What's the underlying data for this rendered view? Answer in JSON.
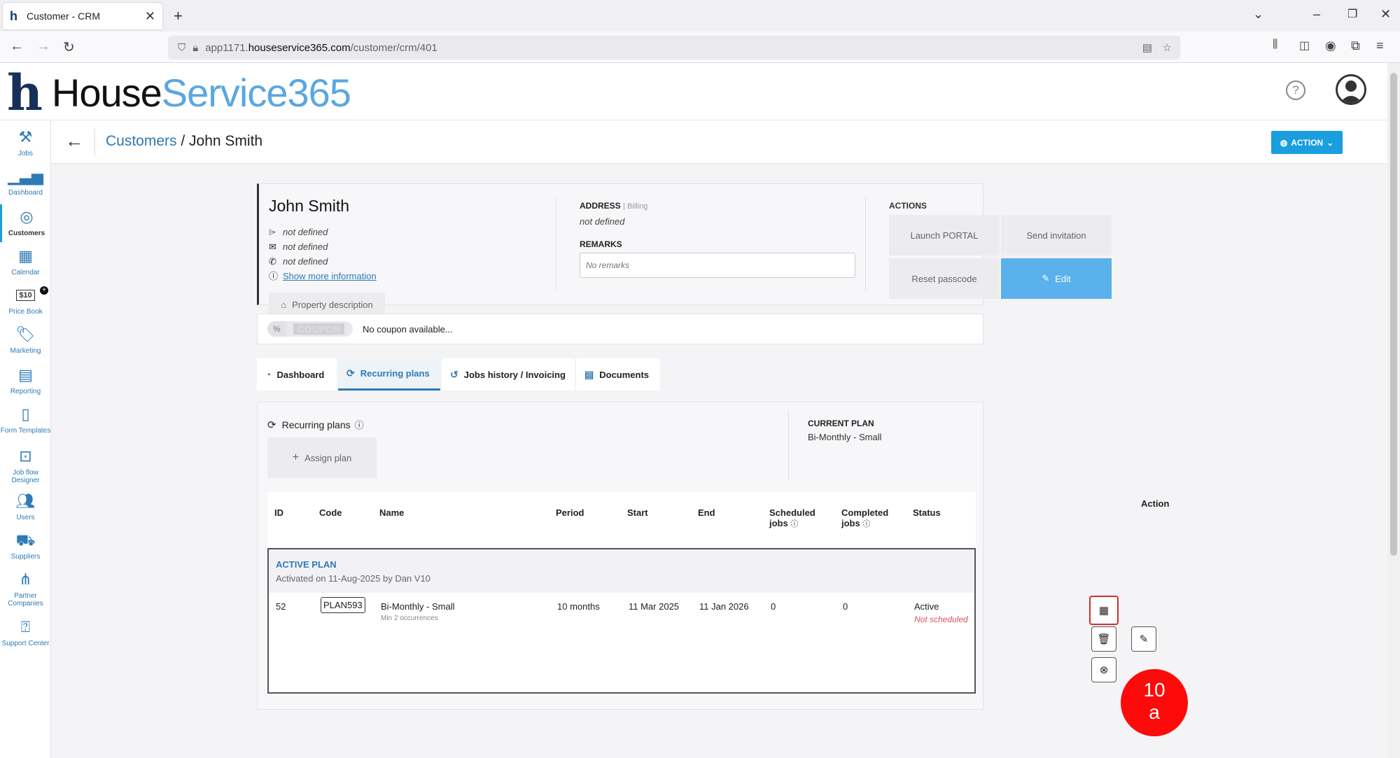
{
  "browser": {
    "tab_title": "Customer - CRM",
    "tab_close": "✕",
    "new_tab": "+",
    "url_prefix": "app1171.",
    "url_domain": "houseservice365.com",
    "url_path": "/customer/crm/401"
  },
  "app": {
    "logo_part1": "House",
    "logo_part2": "Service365"
  },
  "sidebar": {
    "items": [
      {
        "label": "Jobs",
        "icon": "tools-icon"
      },
      {
        "label": "Dashboard",
        "icon": "bar-chart-icon"
      },
      {
        "label": "Customers",
        "icon": "target-icon"
      },
      {
        "label": "Calendar",
        "icon": "calendar-icon"
      },
      {
        "label": "Price Book",
        "icon": "price-tag-icon",
        "badge": "$10"
      },
      {
        "label": "Marketing",
        "icon": "tag-icon"
      },
      {
        "label": "Reporting",
        "icon": "report-icon"
      },
      {
        "label": "Form Templates",
        "icon": "form-icon"
      },
      {
        "label": "Job flow Designer",
        "icon": "flow-icon"
      },
      {
        "label": "Users",
        "icon": "users-icon"
      },
      {
        "label": "Suppliers",
        "icon": "truck-icon"
      },
      {
        "label": "Partner Companies",
        "icon": "partners-icon"
      },
      {
        "label": "Support Center",
        "icon": "help-icon"
      }
    ]
  },
  "breadcrumb": {
    "parent": "Customers",
    "separator": " / ",
    "current": "John Smith"
  },
  "action_button": "ACTION",
  "customer": {
    "name": "John Smith",
    "field1": "not defined",
    "field2": "not defined",
    "field3": "not defined",
    "show_more": "Show more information",
    "property_description": "Property description",
    "address_label": "ADDRESS",
    "address_sub": "Billing",
    "address_value": "not defined",
    "remarks_label": "REMARKS",
    "remarks_placeholder": "No remarks",
    "actions_label": "ACTIONS",
    "launch_portal": "Launch PORTAL",
    "send_invitation": "Send invitation",
    "reset_passcode": "Reset passcode",
    "edit": "Edit"
  },
  "coupon": {
    "pct": "%",
    "label": "COUPON",
    "text": "No coupon available..."
  },
  "tabs": [
    {
      "label": "Dashboard"
    },
    {
      "label": "Recurring plans"
    },
    {
      "label": "Jobs history / Invoicing"
    },
    {
      "label": "Documents"
    }
  ],
  "plans": {
    "title": "Recurring plans",
    "assign": "Assign plan",
    "current_plan_label": "CURRENT PLAN",
    "current_plan_value": "Bi-Monthly - Small",
    "columns": {
      "id": "ID",
      "code": "Code",
      "name": "Name",
      "period": "Period",
      "start": "Start",
      "end": "End",
      "scheduled": "Scheduled",
      "completed": "Completed",
      "jobs": "jobs",
      "status": "Status",
      "action": "Action"
    },
    "active_plan_label": "ACTIVE PLAN",
    "activated_text": "Activated on 11-Aug-2025 by Dan V10",
    "row": {
      "id": "52",
      "code": "PLAN593",
      "name": "Bi-Monthly - Small",
      "name_sub": "Min 2 occurrences",
      "period": "10 months",
      "start": "11 Mar 2025",
      "end": "11 Jan 2026",
      "scheduled": "0",
      "completed": "0",
      "status": "Active",
      "status_sub": "Not scheduled"
    }
  },
  "annotation": {
    "line1": "10",
    "line2": "a"
  }
}
